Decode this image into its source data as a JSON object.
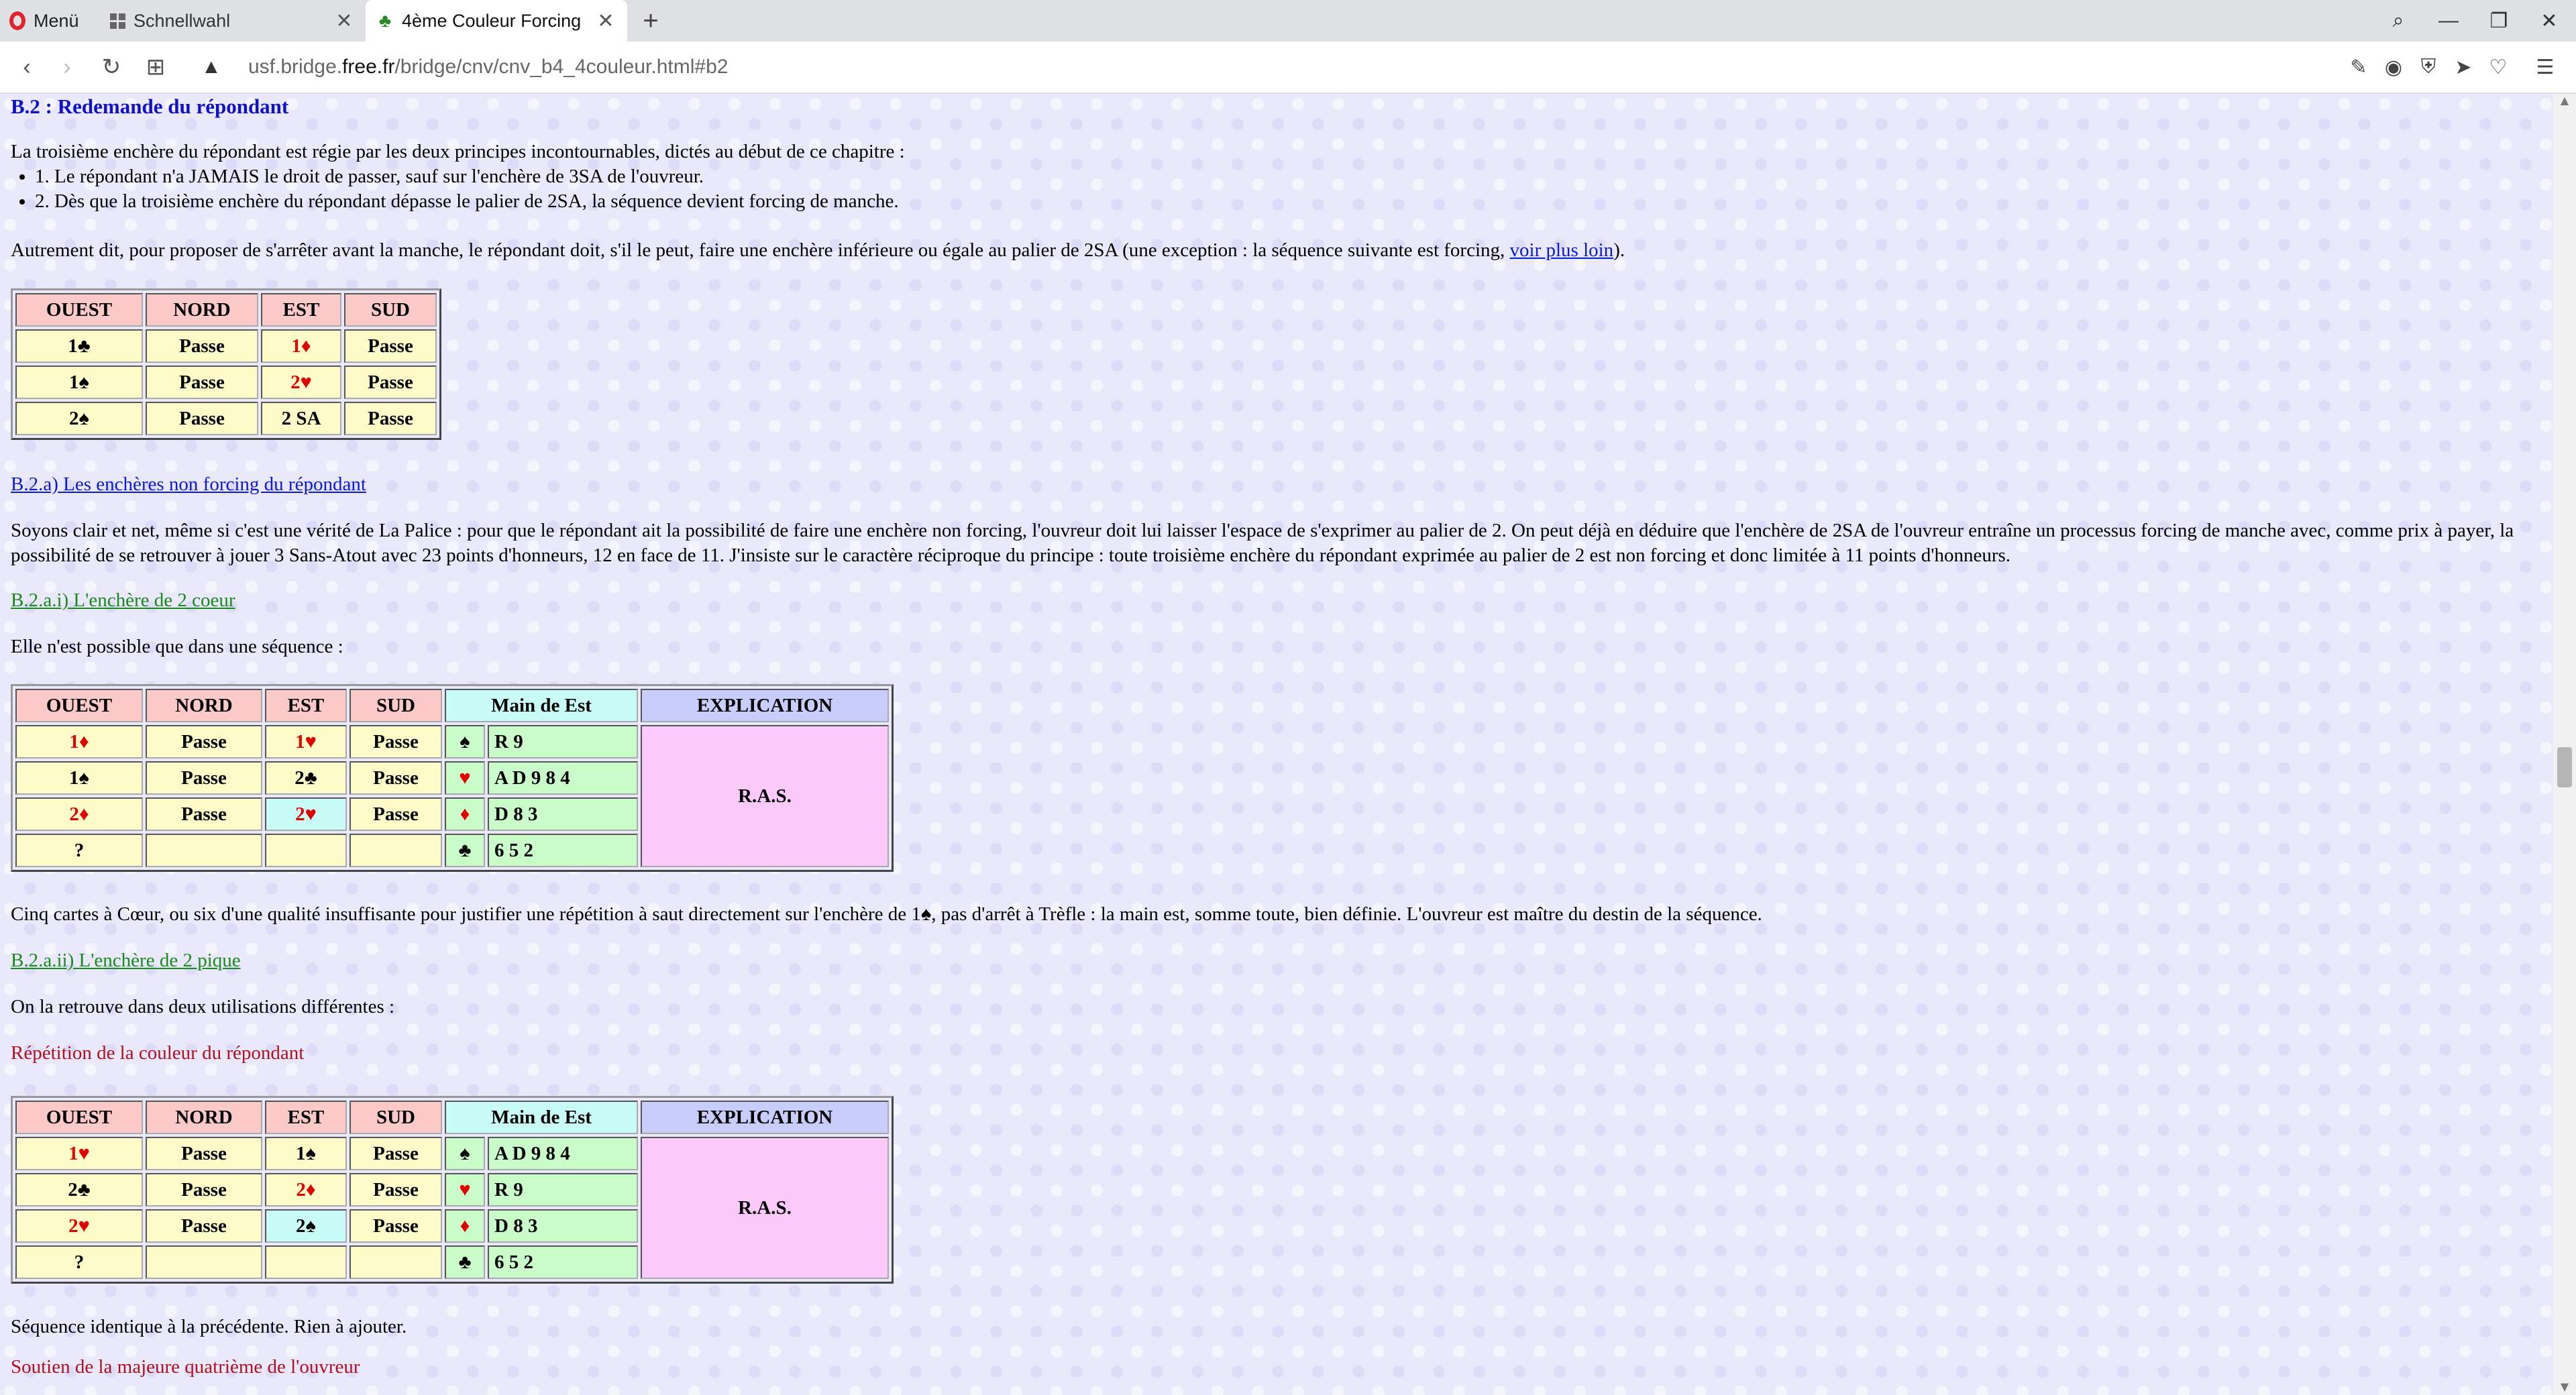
{
  "browser": {
    "menu_label": "Menü",
    "tabs": [
      {
        "title": "Schnellwahl",
        "active": false
      },
      {
        "title": "4ème Couleur Forcing",
        "active": true
      }
    ],
    "url_prefix": "usf.bridge.",
    "url_host": "free.fr",
    "url_path": "/bridge/cnv/cnv_b4_4couleur.html#b2"
  },
  "page": {
    "section_title": "B.2 : Redemande du répondant",
    "intro": "La troisième enchère du répondant est régie par les deux principes incontournables, dictés au début de ce chapitre :",
    "rules": [
      "1. Le répondant n'a JAMAIS le droit de passer, sauf sur l'enchère de 3SA de l'ouvreur.",
      "2. Dès que la troisième enchère du répondant dépasse le palier de 2SA, la séquence devient forcing de manche."
    ],
    "autrement_text": "Autrement dit, pour proposer de s'arrêter avant la manche, le répondant doit, s'il le peut, faire une enchère inférieure ou égale au palier de 2SA (une exception : la séquence suivante est forcing, ",
    "autrement_link": "voir plus loin",
    "autrement_end": ").",
    "table1": {
      "headers": [
        "OUEST",
        "NORD",
        "EST",
        "SUD"
      ],
      "rows": [
        [
          {
            "t": "1♣",
            "c": "blk"
          },
          {
            "t": "Passe"
          },
          {
            "t": "1♦",
            "c": "red"
          },
          {
            "t": "Passe"
          }
        ],
        [
          {
            "t": "1♠",
            "c": "blk"
          },
          {
            "t": "Passe"
          },
          {
            "t": "2♥",
            "c": "red"
          },
          {
            "t": "Passe"
          }
        ],
        [
          {
            "t": "2♠",
            "c": "blk"
          },
          {
            "t": "Passe"
          },
          {
            "t": "2 SA"
          },
          {
            "t": "Passe"
          }
        ]
      ]
    },
    "link_b2a": "B.2.a) Les enchères non forcing du répondant",
    "para_soyons": "Soyons clair et net, même si c'est une vérité de La Palice : pour que le répondant ait la possibilité de faire une enchère non forcing, l'ouvreur doit lui laisser l'espace de s'exprimer au palier de 2. On peut déjà en déduire que l'enchère de 2SA de l'ouvreur entraîne un processus forcing de manche avec, comme prix à payer, la possibilité de se retrouver à jouer 3 Sans-Atout avec 23 points d'honneurs, 12 en face de 11. J'insiste sur le caractère réciproque du principe : toute troisième enchère du répondant exprimée au palier de 2 est non forcing et donc limitée à 11 points d'honneurs.",
    "link_b2ai": "B.2.a.i) L'enchère de 2 coeur",
    "para_elle": "Elle n'est possible que dans une séquence :",
    "table2": {
      "headers": [
        "OUEST",
        "NORD",
        "EST",
        "SUD",
        "Main de Est",
        "EXPLICATION"
      ],
      "bids": [
        [
          {
            "t": "1♦",
            "c": "red"
          },
          {
            "t": "Passe"
          },
          {
            "t": "1♥",
            "c": "red"
          },
          {
            "t": "Passe"
          }
        ],
        [
          {
            "t": "1♠",
            "c": "blk"
          },
          {
            "t": "Passe"
          },
          {
            "t": "2♣",
            "c": "blk"
          },
          {
            "t": "Passe"
          }
        ],
        [
          {
            "t": "2♦",
            "c": "red"
          },
          {
            "t": "Passe"
          },
          {
            "t": "2♥",
            "c": "red",
            "cyan": true
          },
          {
            "t": "Passe"
          }
        ],
        [
          {
            "t": "?"
          },
          {
            "t": ""
          },
          {
            "t": ""
          },
          {
            "t": ""
          }
        ]
      ],
      "hand": [
        {
          "suit": "♠",
          "c": "blk",
          "cards": "R 9"
        },
        {
          "suit": "♥",
          "c": "red",
          "cards": "A D 9 8 4"
        },
        {
          "suit": "♦",
          "c": "red",
          "cards": "D 8 3"
        },
        {
          "suit": "♣",
          "c": "blk",
          "cards": "6 5 2"
        }
      ],
      "explication": "R.A.S."
    },
    "para_cinq_a": "Cinq cartes à Cœur, ou six d'une qualité insuffisante pour justifier une répétition à saut directement sur l'enchère de 1",
    "para_cinq_suit": "♠",
    "para_cinq_b": ", pas d'arrêt à Trèfle : la main est, somme toute, bien définie. L'ouvreur est maître du destin de la séquence.",
    "link_b2aii": "B.2.a.ii) L'enchère de 2 pique",
    "para_on": "On la retrouve dans deux utilisations différentes :",
    "heading_repetition": "Répétition de la couleur du répondant",
    "table3": {
      "headers": [
        "OUEST",
        "NORD",
        "EST",
        "SUD",
        "Main de Est",
        "EXPLICATION"
      ],
      "bids": [
        [
          {
            "t": "1♥",
            "c": "red"
          },
          {
            "t": "Passe"
          },
          {
            "t": "1♠",
            "c": "blk"
          },
          {
            "t": "Passe"
          }
        ],
        [
          {
            "t": "2♣",
            "c": "blk"
          },
          {
            "t": "Passe"
          },
          {
            "t": "2♦",
            "c": "red"
          },
          {
            "t": "Passe"
          }
        ],
        [
          {
            "t": "2♥",
            "c": "red"
          },
          {
            "t": "Passe"
          },
          {
            "t": "2♠",
            "c": "blk",
            "cyan": true
          },
          {
            "t": "Passe"
          }
        ],
        [
          {
            "t": "?"
          },
          {
            "t": ""
          },
          {
            "t": ""
          },
          {
            "t": ""
          }
        ]
      ],
      "hand": [
        {
          "suit": "♠",
          "c": "blk",
          "cards": "A D 9 8 4"
        },
        {
          "suit": "♥",
          "c": "red",
          "cards": "R 9"
        },
        {
          "suit": "♦",
          "c": "red",
          "cards": "D 8 3"
        },
        {
          "suit": "♣",
          "c": "blk",
          "cards": "6 5 2"
        }
      ],
      "explication": "R.A.S."
    },
    "para_sequence": "Séquence identique à la précédente. Rien à ajouter.",
    "heading_soutien": "Soutien de la majeure quatrième de l'ouvreur"
  }
}
